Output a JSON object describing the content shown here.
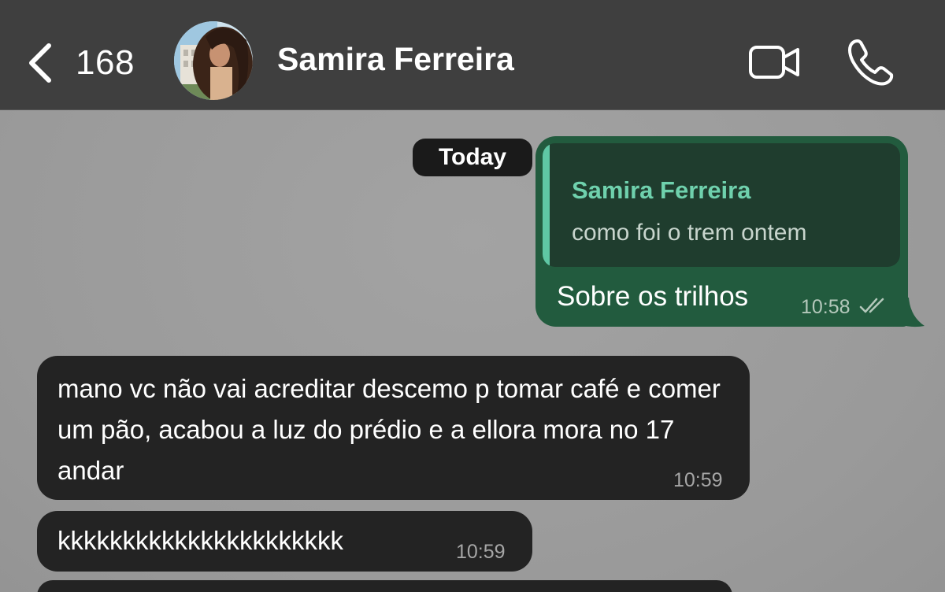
{
  "header": {
    "back_count": "168",
    "contact_name": "Samira Ferreira"
  },
  "chat": {
    "date_label": "Today",
    "outgoing": {
      "quote_author": "Samira Ferreira",
      "quote_text": "como foi o trem ontem",
      "text": "Sobre os trilhos",
      "time": "10:58",
      "status_icon": "double-check-icon"
    },
    "incoming": [
      {
        "text": "mano vc não vai acreditar descemo p tomar café e comer um pão, acabou a luz do prédio e a ellora mora no 17 andar",
        "time": "10:59"
      },
      {
        "text": "kkkkkkkkkkkkkkkkkkkkkk",
        "time": "10:59"
      }
    ]
  },
  "colors": {
    "header_bg": "#3f3f3f",
    "outgoing_bubble": "#225b3e",
    "quote_accent": "#5fc7a4",
    "incoming_bubble": "#232323",
    "chat_bg": "#9c9c9c"
  }
}
